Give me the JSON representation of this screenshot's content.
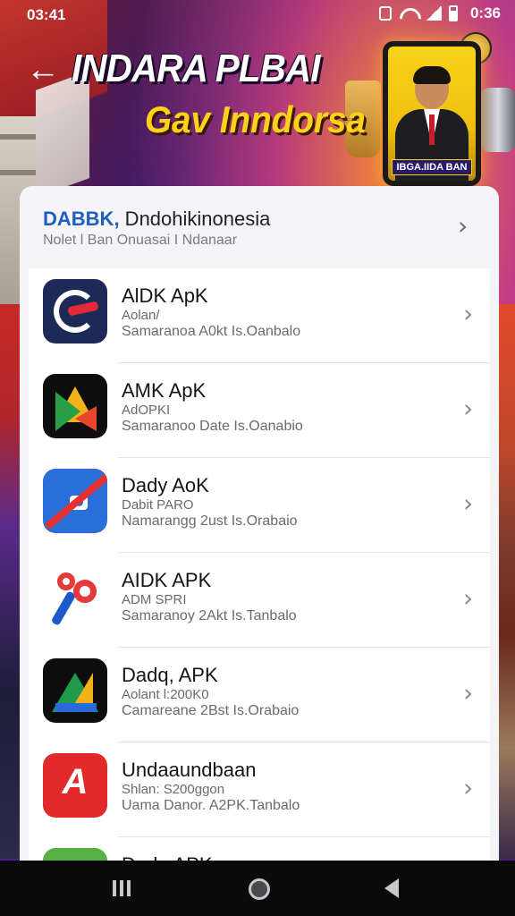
{
  "status_bar": {
    "time": "03:41",
    "clock": "0:36"
  },
  "banner": {
    "title": "INDARA PLBAI",
    "subtitle": "Gav Inndorsa",
    "phone_caption": "IBGA.IIDA BAN"
  },
  "card_header": {
    "title_accent": "DABBK,",
    "title_rest": " Dndohikinonesia",
    "subtitle": "Nolet l Ban Onuasai I Ndanaar"
  },
  "apps": [
    {
      "name": "AlDK ApK",
      "version": "Aolan/",
      "meta": "Samaranoa A0kt Is.Oanbalo"
    },
    {
      "name": "AMK ApK",
      "version": "AdOPKI",
      "meta": "Samaranoo Date Is.Oanabio"
    },
    {
      "name": "Dady AoK",
      "version": "Dabit PARO",
      "meta": "Namarangg 2ust Is.Orabaio"
    },
    {
      "name": "AIDK APK",
      "version": "ADM SPRI",
      "meta": "Samaranoy 2Akt Is.Tanbalo"
    },
    {
      "name": "Dadq, APK",
      "version": "Aolant l:200K0",
      "meta": "Camareane 2Bst Is.Orabaio"
    },
    {
      "name": "Undaaundbaan",
      "version": "Shlan: S200ggon",
      "meta": "Uama Danor. A2PK.Tanbalo"
    },
    {
      "name": "Dadq APK",
      "version": "",
      "meta": ""
    }
  ],
  "icons": {
    "back": "arrow-left-icon",
    "chevron": "chevron-right-icon"
  },
  "colors": {
    "accent_blue": "#1f5fbf",
    "title_yellow": "#ffd21a"
  }
}
